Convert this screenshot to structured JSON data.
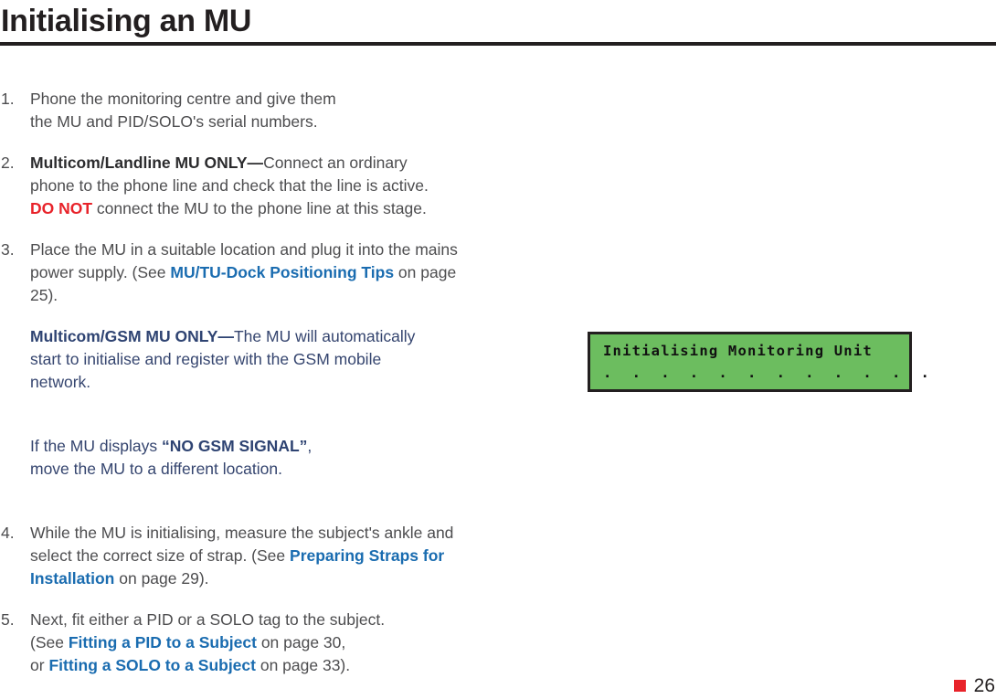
{
  "header": {
    "title": "Initialising an MU"
  },
  "steps": [
    {
      "number": "1.",
      "line1": "Phone the monitoring centre and give them",
      "line2": "the MU and PID/SOLO's serial numbers."
    },
    {
      "number": "2.",
      "bold_lead": "Multicom/Landline MU ONLY—",
      "after_lead": "Connect an ordinary",
      "line2": "phone to the phone line and check that the line is active.",
      "warning": "DO NOT",
      "line3_rest": " connect the MU to the phone line at this stage."
    },
    {
      "number": "3.",
      "line1": "Place the MU in a suitable location and plug it into the mains",
      "line2_pre": "power supply. (See ",
      "line2_link": "MU/TU-Dock Positioning Tips",
      "line2_post": " on page",
      "line3": "25)."
    },
    {
      "number": "4.",
      "line1": "While the MU is initialising, measure the subject's ankle and",
      "line2_pre": "select the correct size of strap. (See ",
      "line2_link": "Preparing Straps for",
      "line3_link": "Installation",
      "line3_post": " on page 29)."
    },
    {
      "number": "5.",
      "line1": "Next, fit either a PID or a SOLO tag to the subject.",
      "line2_pre": "(See ",
      "line2_link": "Fitting a PID to a Subject",
      "line2_post": " on page 30,",
      "line3_pre": "or ",
      "line3_link": "Fitting a SOLO to a Subject",
      "line3_post": " on page 33)."
    }
  ],
  "notes": {
    "gsm": {
      "bold_lead": "Multicom/GSM MU ONLY—",
      "after_lead": "The MU will automatically",
      "line2": "start to initialise and register with the GSM mobile",
      "line3": "network."
    },
    "signal": {
      "line1_pre": "If the MU displays ",
      "line1_bold": "“NO GSM SIGNAL”",
      "line1_post": ",",
      "line2": "move the MU to a different location."
    }
  },
  "lcd": {
    "line1": "Initialising Monitoring Unit",
    "line2": ".  .  .  .  .  .  .  .  .  .  .  ."
  },
  "footer": {
    "marker_icon": "red-square-marker",
    "page_number": "26"
  },
  "colors": {
    "accent_red": "#e8232a",
    "link_blue": "#1a6cb0",
    "navy": "#35456f",
    "lcd_green": "#6cbd5f",
    "rule_black": "#231f20"
  }
}
